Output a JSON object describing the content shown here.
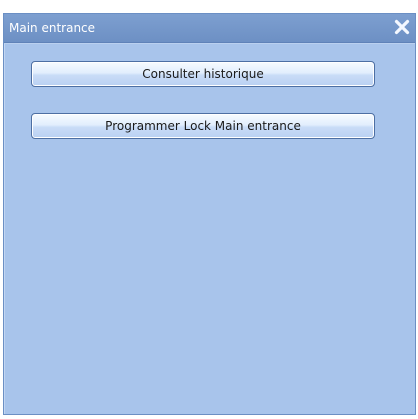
{
  "window": {
    "title": "Main entrance",
    "close_icon": "close-icon",
    "colors": {
      "titlebar": "#7d9fd0",
      "background": "#a8c4eb",
      "border": "#6b8fc4"
    }
  },
  "buttons": [
    {
      "label": "Consulter historique"
    },
    {
      "label": "Programmer Lock Main entrance"
    }
  ]
}
